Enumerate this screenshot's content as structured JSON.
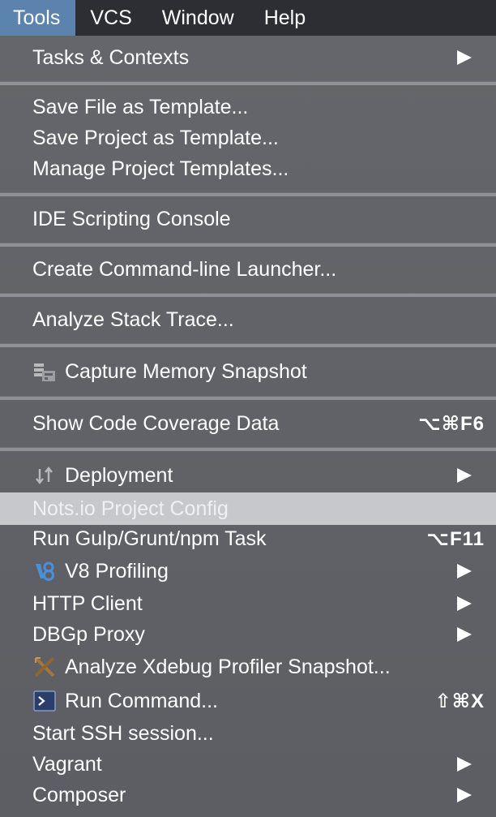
{
  "menubar": {
    "items": [
      "Tools",
      "VCS",
      "Window",
      "Help"
    ]
  },
  "menu": {
    "tasks_contexts": "Tasks & Contexts",
    "save_file_template": "Save File as Template...",
    "save_project_template": "Save Project as Template...",
    "manage_project_templates": "Manage Project Templates...",
    "ide_scripting_console": "IDE Scripting Console",
    "create_launcher": "Create Command-line Launcher...",
    "analyze_stack_trace": "Analyze Stack Trace...",
    "capture_memory": "Capture Memory Snapshot",
    "show_coverage": "Show Code Coverage Data",
    "show_coverage_shortcut": "⌥⌘F6",
    "deployment": "Deployment",
    "notsio": "Nots.io Project Config",
    "run_gulp": "Run Gulp/Grunt/npm Task",
    "run_gulp_shortcut": "⌥F11",
    "v8_profiling": "V8 Profiling",
    "http_client": "HTTP Client",
    "dbgp_proxy": "DBGp Proxy",
    "xdebug": "Analyze Xdebug Profiler Snapshot...",
    "run_command": "Run Command...",
    "run_command_shortcut": "⇧⌘X",
    "ssh_session": "Start SSH session...",
    "vagrant": "Vagrant",
    "composer": "Composer"
  },
  "colors": {
    "menubar_bg": "#2c2e33",
    "active_menu": "#5c83ad",
    "menu_bg": "#606267",
    "highlight": "#c6c8cc"
  },
  "icons": {
    "submenu": "submenu-arrow-icon",
    "capture_memory": "memory-snapshot-icon",
    "deployment": "deployment-arrows-icon",
    "v8": "v8-icon",
    "xdebug": "xdebug-icon",
    "run_command": "terminal-icon"
  }
}
